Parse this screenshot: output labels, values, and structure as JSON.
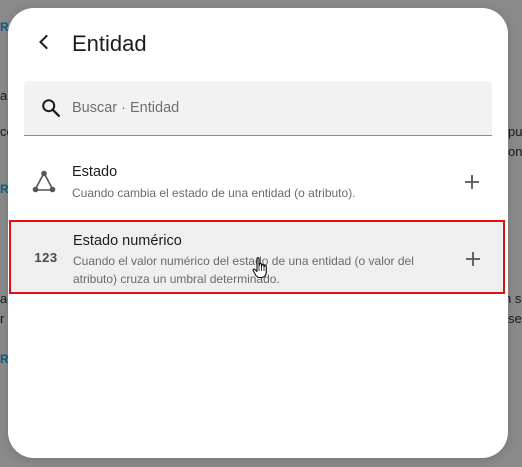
{
  "dialog": {
    "title": "Entidad",
    "back_icon": "chevron-left-icon"
  },
  "search": {
    "placeholder": "Buscar · Entidad",
    "value": "",
    "icon": "search-icon"
  },
  "items": [
    {
      "title": "Estado",
      "description": "Cuando cambia el estado de una entidad (o atributo).",
      "icon": "state-graph-icon",
      "action_icon": "plus-icon"
    },
    {
      "title": "Estado numérico",
      "description": "Cuando el valor numérico del estado de una entidad (o valor del atributo) cruza un umbral determinado.",
      "icon_text": "123",
      "icon": "numeric-icon",
      "action_icon": "plus-icon",
      "highlighted": true
    }
  ],
  "background": {
    "fragments": [
      "R",
      "al",
      "co",
      "R",
      "ac",
      "r",
      "R",
      "pu",
      "on",
      "n s",
      "se"
    ]
  },
  "colors": {
    "highlight_border": "#e01010",
    "highlight_bg": "#efefef",
    "backdrop": "#8a8a8a",
    "link": "#0b5e8a"
  }
}
